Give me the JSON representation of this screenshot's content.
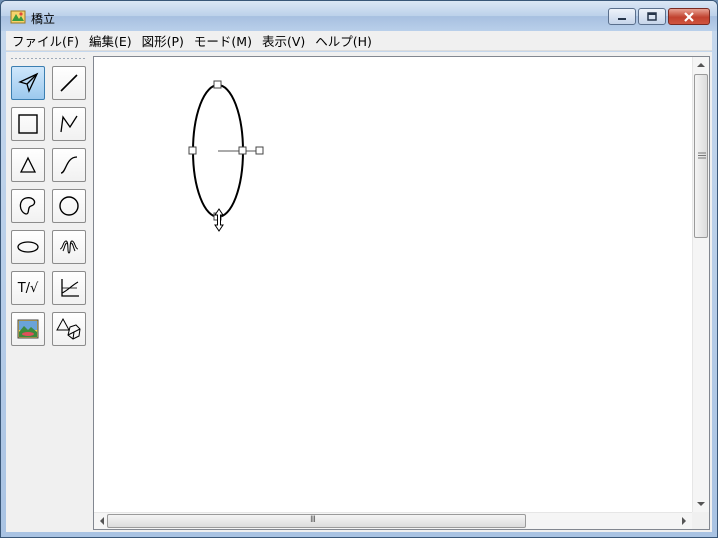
{
  "window": {
    "title": "橋立",
    "app_icon": "app-icon",
    "caption_buttons": [
      "minimize-icon",
      "maximize-icon",
      "close-icon"
    ]
  },
  "menu": [
    {
      "id": "file",
      "label": "ファイル(F)"
    },
    {
      "id": "edit",
      "label": "編集(E)"
    },
    {
      "id": "shape",
      "label": "図形(P)"
    },
    {
      "id": "mode",
      "label": "モード(M)"
    },
    {
      "id": "view",
      "label": "表示(V)"
    },
    {
      "id": "help",
      "label": "ヘルプ(H)"
    }
  ],
  "toolbox": {
    "tools": [
      {
        "name": "select-arrow-tool",
        "icon": "select-arrow-icon",
        "active": true
      },
      {
        "name": "line-tool",
        "icon": "line-icon"
      },
      {
        "name": "rectangle-tool",
        "icon": "rectangle-icon"
      },
      {
        "name": "polyline-tool",
        "icon": "polyline-icon"
      },
      {
        "name": "triangle-tool",
        "icon": "triangle-icon"
      },
      {
        "name": "curve-tool",
        "icon": "curve-icon"
      },
      {
        "name": "freeform-tool",
        "icon": "freeform-closed-curve-icon"
      },
      {
        "name": "circle-tool",
        "icon": "circle-icon"
      },
      {
        "name": "ellipse-tool",
        "icon": "ellipse-icon"
      },
      {
        "name": "spiral-tool",
        "icon": "spiral-icon"
      },
      {
        "name": "text-formula-tool",
        "icon": "text-formula-icon",
        "label": "T/√"
      },
      {
        "name": "graph-tool",
        "icon": "graph-axes-icon"
      },
      {
        "name": "image-tool",
        "icon": "picture-icon"
      },
      {
        "name": "3d-shapes-tool",
        "icon": "solid-shapes-icon"
      }
    ]
  },
  "canvas": {
    "shapes": [
      {
        "type": "ellipse",
        "selected": true,
        "handles": [
          "top",
          "left",
          "center",
          "rotation",
          "bottom"
        ]
      }
    ],
    "cursor": "resize-vertical-cursor"
  },
  "scrollbars": {
    "vertical": {
      "grip_icon": "scroll-grip-icon"
    },
    "horizontal": {
      "grip_icon": "scroll-grip-icon",
      "grip_label": "III"
    }
  }
}
